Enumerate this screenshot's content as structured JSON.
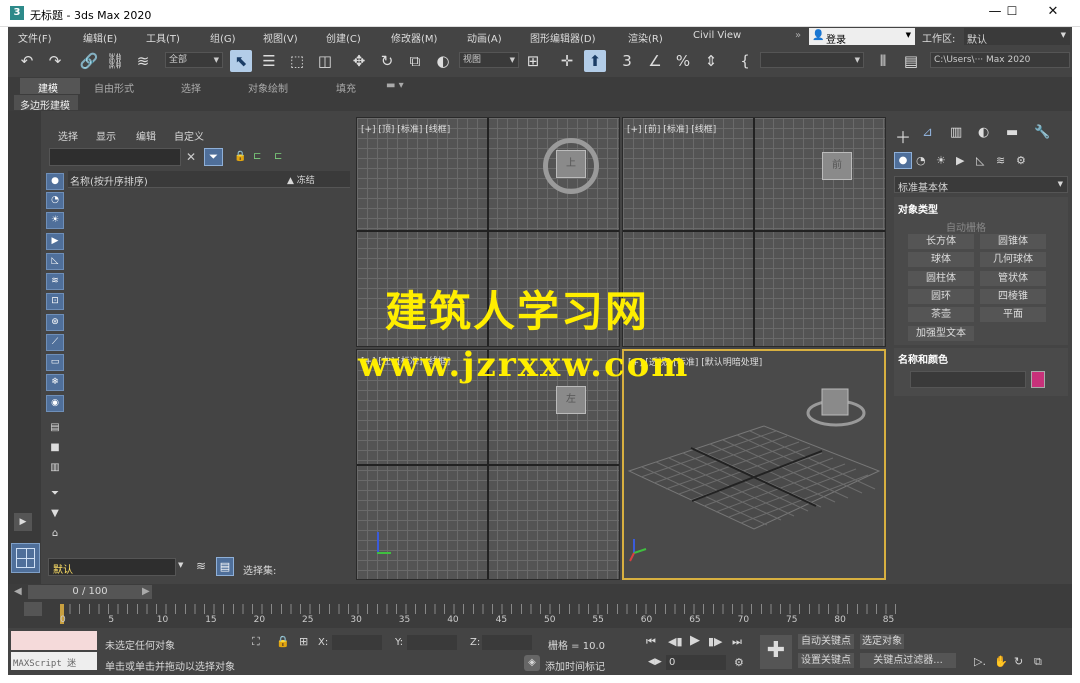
{
  "window": {
    "title": "无标题 - 3ds Max 2020"
  },
  "menu": [
    "文件(F)",
    "编辑(E)",
    "工具(T)",
    "组(G)",
    "视图(V)",
    "创建(C)",
    "修改器(M)",
    "动画(A)",
    "图形编辑器(D)",
    "渲染(R)",
    "Civil View"
  ],
  "login": "登录",
  "workspace": {
    "label": "工作区:",
    "value": "默认"
  },
  "toolbar": {
    "filter": "全部",
    "refcoord": "视图",
    "path": "C:\\Users\\··· Max 2020"
  },
  "ribbon": {
    "tabs": [
      "建模",
      "自由形式",
      "选择",
      "对象绘制",
      "填充"
    ],
    "sub": "多边形建模"
  },
  "scene": {
    "menu": [
      "选择",
      "显示",
      "编辑",
      "自定义"
    ],
    "col_name": "名称(按升序排序)",
    "col_freeze": "▲ 冻结",
    "layer": "默认",
    "selset": "选择集:"
  },
  "viewports": {
    "top": "[+] [顶] [标准] [线框]",
    "front": "[+] [前] [标准] [线框]",
    "left": "[+] [左] [标准] [线框]",
    "persp": "[+] [透视] [标准] [默认明暗处理]",
    "cube_top": "上",
    "cube_front": "前",
    "cube_left": "左"
  },
  "cmd": {
    "category": "标准基本体",
    "obj_type": "对象类型",
    "autogrid": "自动栅格",
    "buttons": [
      "长方体",
      "圆锥体",
      "球体",
      "几何球体",
      "圆柱体",
      "管状体",
      "圆环",
      "四棱锥",
      "茶壶",
      "平面",
      "加强型文本"
    ],
    "name_color": "名称和颜色",
    "swatch": "#c8317a"
  },
  "timeline": {
    "frame": "0 / 100",
    "ticks": [
      "0",
      "5",
      "10",
      "15",
      "20",
      "25",
      "30",
      "35",
      "40",
      "45",
      "50",
      "55",
      "60",
      "65",
      "70",
      "75",
      "80",
      "85"
    ]
  },
  "status": {
    "maxscript": "MAXScript 迷",
    "line1": "未选定任何对象",
    "line2": "单击或单击并拖动以选择对象",
    "x": "X:",
    "y": "Y:",
    "z": "Z:",
    "grid": "栅格 = 10.0",
    "addtime": "添加时间标记",
    "autokey": "自动关键点",
    "selobj": "选定对象",
    "setkey": "设置关键点",
    "keyfilter": "关键点过滤器...",
    "frame": "0"
  },
  "watermark": {
    "line1": "建筑人学习网",
    "line2": "www.jzrxxw.com"
  }
}
